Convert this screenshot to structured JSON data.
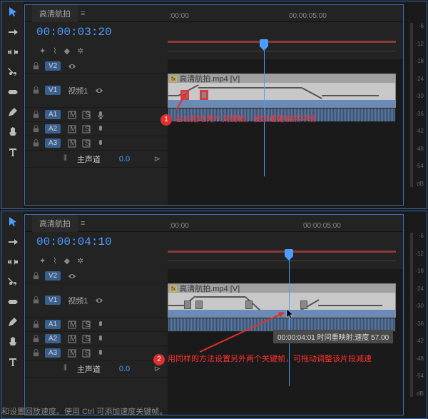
{
  "panel1": {
    "tab": "高清航拍",
    "timecode": "00:00:03:20",
    "ruler": {
      "t0": ":00:00",
      "t1": "00:00:05:00"
    },
    "tracks": {
      "v2": "V2",
      "v1": "V1",
      "v1_label": "视频1",
      "a1": "A1",
      "a2": "A2",
      "a3": "A3",
      "master": "主声道",
      "master_val": "0.0"
    },
    "clip": {
      "label": "高清航拍.mp4 [V]",
      "fx": "fx"
    },
    "annotation": {
      "num": "1",
      "text": "左右拖动两个关键帧，使加速更自然平滑"
    }
  },
  "panel2": {
    "tab": "高清航拍",
    "timecode": "00:00:04:10",
    "ruler": {
      "t0": ":00:00",
      "t1": "00:00:05:00"
    },
    "tracks": {
      "v2": "V2",
      "v1": "V1",
      "v1_label": "视频1",
      "a1": "A1",
      "a2": "A2",
      "a3": "A3",
      "master": "主声道",
      "master_val": "0.0"
    },
    "clip": {
      "label": "高清航拍.mp4 [V]",
      "fx": "fx"
    },
    "tooltip": "00:00:04:01  时间重映射:速度  57.00",
    "annotation": {
      "num": "2",
      "text": "用同样的方法设置另外两个关键帧，可拖动调整该片段减速"
    }
  },
  "meter_labels": [
    "-6",
    "-12",
    "-18",
    "-24",
    "-30",
    "-36",
    "-42",
    "-48",
    "-54",
    "dB"
  ],
  "footer": "和设置回放速度。使用 Ctrl 可添加速度关键帧。"
}
